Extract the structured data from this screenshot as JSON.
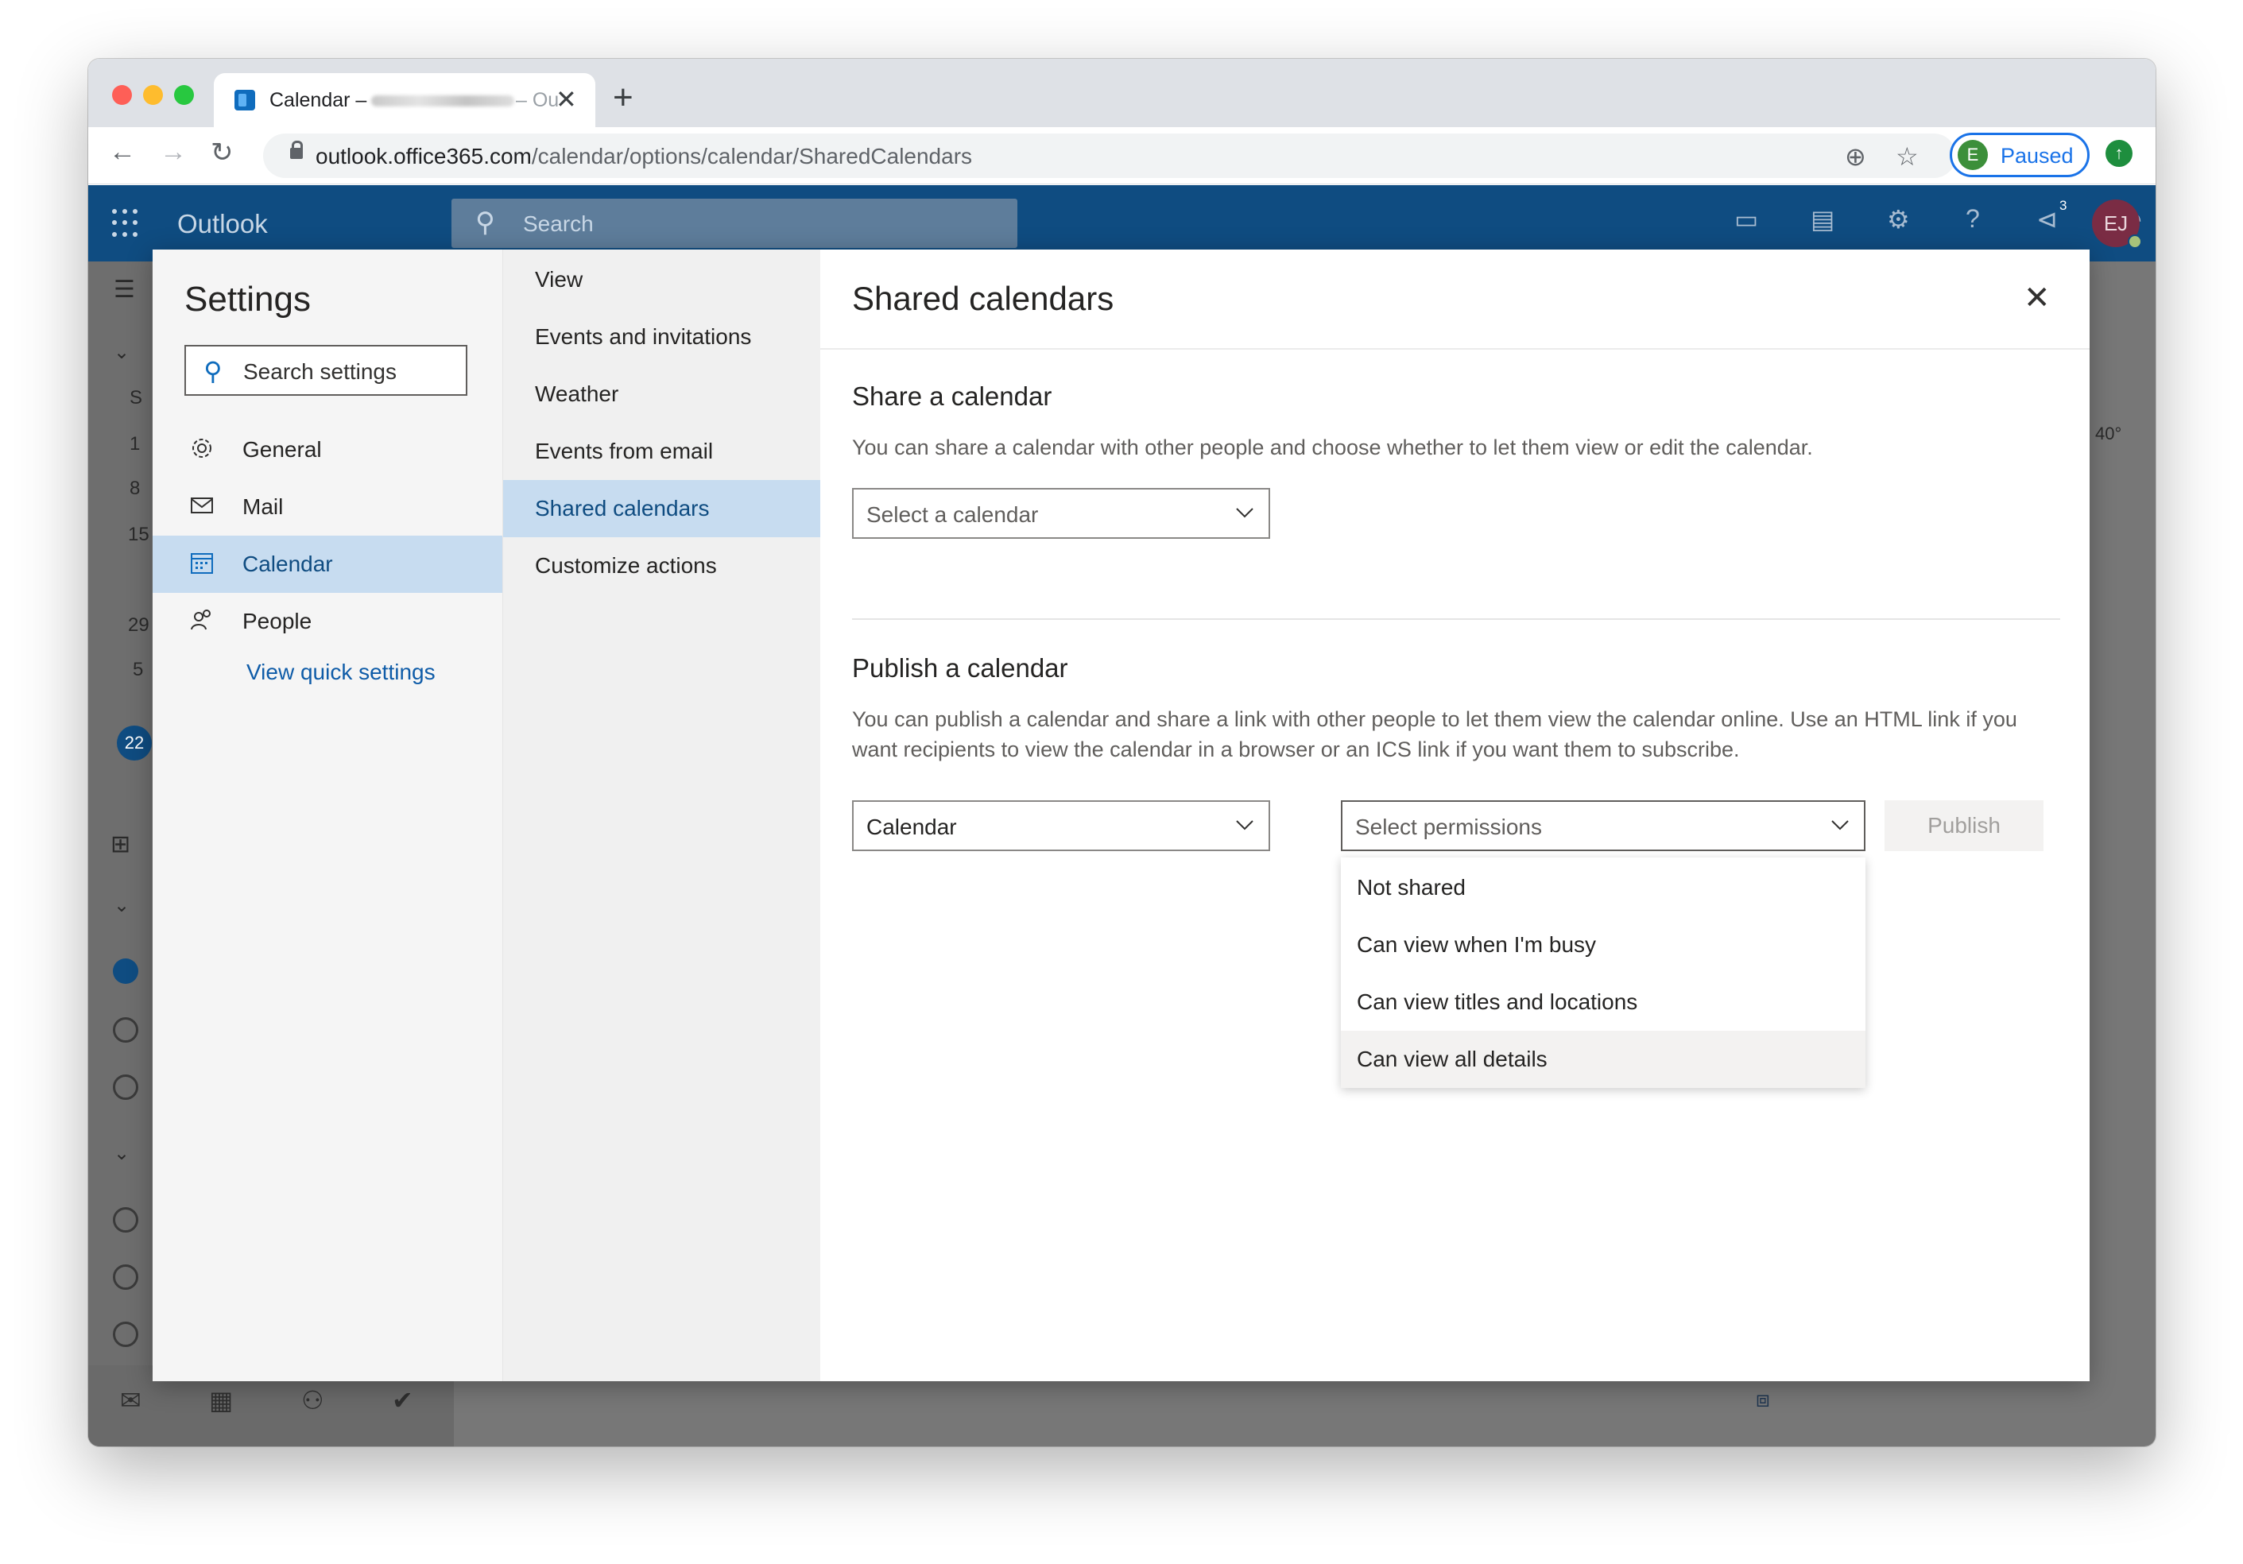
{
  "browser": {
    "tab_title": "Calendar –",
    "tab_title_suffix": "– Ou",
    "url_host": "outlook.office365.com",
    "url_path": "/calendar/options/calendar/SharedCalendars",
    "profile_initial": "E",
    "profile_label": "Paused"
  },
  "suite": {
    "brand": "Outlook",
    "search_placeholder": "Search",
    "notification_count": "3",
    "avatar_initials": "EJ"
  },
  "calendar_bg": {
    "weather": "40°",
    "days": [
      "S",
      "1",
      "8",
      "15",
      "22",
      "29",
      "5"
    ]
  },
  "settings": {
    "title": "Settings",
    "search_placeholder": "Search settings",
    "categories": [
      {
        "label": "General",
        "icon": "gear-icon"
      },
      {
        "label": "Mail",
        "icon": "mail-icon"
      },
      {
        "label": "Calendar",
        "icon": "calendar-icon"
      },
      {
        "label": "People",
        "icon": "people-icon"
      }
    ],
    "quick_settings_link": "View quick settings",
    "subcategories": [
      {
        "label": "View"
      },
      {
        "label": "Events and invitations"
      },
      {
        "label": "Weather"
      },
      {
        "label": "Events from email"
      },
      {
        "label": "Shared calendars"
      },
      {
        "label": "Customize actions"
      }
    ]
  },
  "panel": {
    "title": "Shared calendars",
    "share": {
      "title": "Share a calendar",
      "description": "You can share a calendar with other people and choose whether to let them view or edit the calendar.",
      "select_placeholder": "Select a calendar"
    },
    "publish": {
      "title": "Publish a calendar",
      "description": "You can publish a calendar and share a link with other people to let them view the calendar online. Use an HTML link if you want recipients to view the calendar in a browser or an ICS link if you want them to subscribe.",
      "calendar_value": "Calendar",
      "permissions_placeholder": "Select permissions",
      "publish_label": "Publish",
      "permission_options": [
        "Not shared",
        "Can view when I'm busy",
        "Can view titles and locations",
        "Can view all details"
      ]
    }
  },
  "colors": {
    "suite_bar": "#0f4c81",
    "selected_nav": "#c7dcf0",
    "accent_text": "#0f4c81",
    "link": "#0f5ca8"
  }
}
